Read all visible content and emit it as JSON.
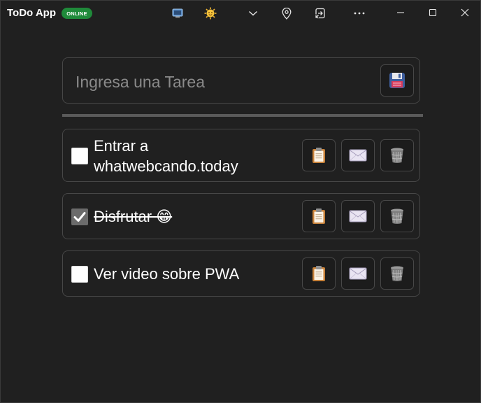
{
  "titlebar": {
    "app_title": "ToDo App",
    "status_badge": "ONLINE"
  },
  "input": {
    "placeholder": "Ingresa una Tarea",
    "value": ""
  },
  "tasks": [
    {
      "line1": "Entrar a",
      "line2": "whatwebcando.today",
      "done": false
    },
    {
      "text": "Disfrutar 😁",
      "done": true
    },
    {
      "text": "Ver video sobre PWA",
      "done": false
    }
  ],
  "colors": {
    "background": "#202020",
    "border": "#474747",
    "badge": "#1f8a3a"
  }
}
